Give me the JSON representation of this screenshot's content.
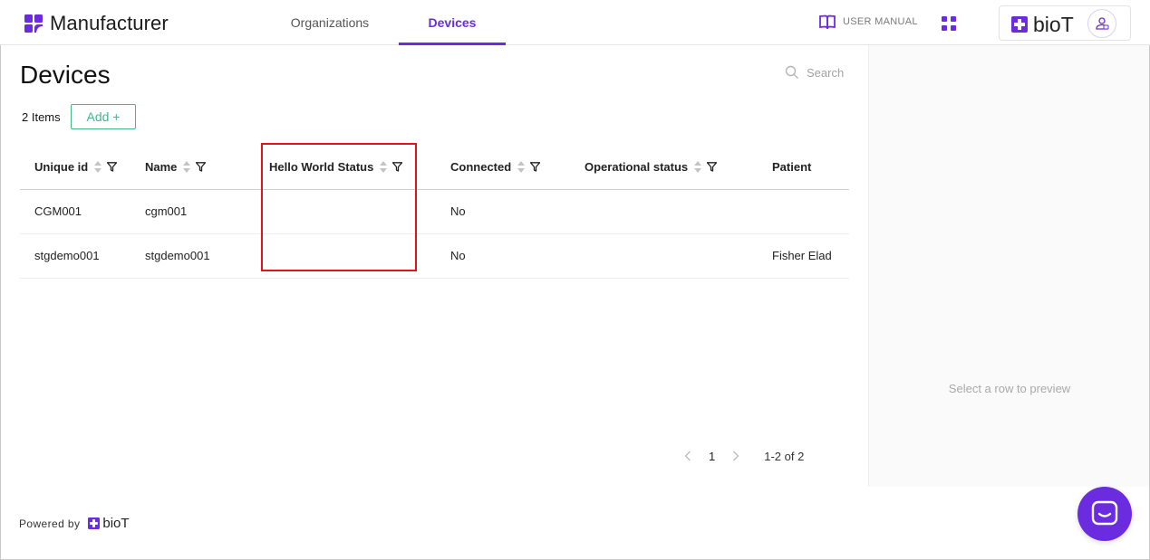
{
  "app": {
    "brand_title": "Manufacturer",
    "accent_color": "#6b2ce0",
    "secondary_brand": "bioT"
  },
  "nav": {
    "tabs": [
      {
        "label": "Organizations",
        "active": false
      },
      {
        "label": "Devices",
        "active": true
      }
    ],
    "user_manual_label": "USER MANUAL",
    "apps_icon": "apps-grid-icon",
    "avatar_icon": "user-avatar-icon"
  },
  "main": {
    "page_title": "Devices",
    "search_placeholder": "Search",
    "items_count": "2 Items",
    "add_button": "Add +",
    "table": {
      "columns": [
        {
          "label": "Unique id",
          "sortable": true,
          "filterable": true
        },
        {
          "label": "Name",
          "sortable": true,
          "filterable": true
        },
        {
          "label": "Hello World Status",
          "sortable": true,
          "filterable": true
        },
        {
          "label": "Connected",
          "sortable": true,
          "filterable": true
        },
        {
          "label": "Operational status",
          "sortable": true,
          "filterable": true
        },
        {
          "label": "Patient",
          "sortable": false,
          "filterable": false
        }
      ],
      "rows": [
        [
          "CGM001",
          "cgm001",
          "",
          "No",
          "",
          ""
        ],
        [
          "stgdemo001",
          "stgdemo001",
          "",
          "No",
          "",
          "Fisher Elad"
        ]
      ],
      "highlight_color": "#e0141b"
    },
    "pagination": {
      "current_page": "1",
      "range_text": "1-2 of 2"
    }
  },
  "preview": {
    "empty_text": "Select a row to preview"
  },
  "footer": {
    "powered_by": "Powered by",
    "powered_brand": "bioT"
  },
  "chat": {
    "icon": "chat-bubble-icon"
  }
}
